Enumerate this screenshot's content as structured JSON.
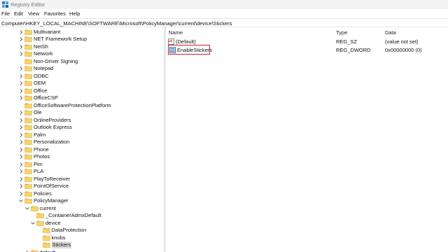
{
  "window": {
    "title": "Registry Editor"
  },
  "menu": [
    "File",
    "Edit",
    "View",
    "Favorites",
    "Help"
  ],
  "address": "Computer\\HKEY_LOCAL_MACHINE\\SOFTWARE\\Microsoft\\PolicyManager\\current\\device\\Stickers",
  "tree": [
    {
      "label": "Multivariant",
      "level": 0,
      "expander": "collapsed"
    },
    {
      "label": "NET Framework Setup",
      "level": 0,
      "expander": "collapsed"
    },
    {
      "label": "NetSh",
      "level": 0,
      "expander": "collapsed"
    },
    {
      "label": "Network",
      "level": 0,
      "expander": "collapsed"
    },
    {
      "label": "Non-Driver Signing",
      "level": 0,
      "expander": "none"
    },
    {
      "label": "Notepad",
      "level": 0,
      "expander": "collapsed"
    },
    {
      "label": "ODBC",
      "level": 0,
      "expander": "collapsed"
    },
    {
      "label": "OEM",
      "level": 0,
      "expander": "collapsed"
    },
    {
      "label": "Office",
      "level": 0,
      "expander": "collapsed"
    },
    {
      "label": "OfficeCSP",
      "level": 0,
      "expander": "collapsed"
    },
    {
      "label": "OfficeSoftwareProtectionPlatform",
      "level": 0,
      "expander": "none"
    },
    {
      "label": "Ole",
      "level": 0,
      "expander": "collapsed"
    },
    {
      "label": "OnlineProviders",
      "level": 0,
      "expander": "collapsed"
    },
    {
      "label": "Outlook Express",
      "level": 0,
      "expander": "collapsed"
    },
    {
      "label": "Palm",
      "level": 0,
      "expander": "collapsed"
    },
    {
      "label": "Personalization",
      "level": 0,
      "expander": "collapsed"
    },
    {
      "label": "Phone",
      "level": 0,
      "expander": "collapsed"
    },
    {
      "label": "Photos",
      "level": 0,
      "expander": "collapsed"
    },
    {
      "label": "Pim",
      "level": 0,
      "expander": "collapsed"
    },
    {
      "label": "PLA",
      "level": 0,
      "expander": "collapsed"
    },
    {
      "label": "PlayToReceiver",
      "level": 0,
      "expander": "collapsed"
    },
    {
      "label": "PointOfService",
      "level": 0,
      "expander": "collapsed"
    },
    {
      "label": "Policies",
      "level": 0,
      "expander": "collapsed"
    },
    {
      "label": "PolicyManager",
      "level": 0,
      "expander": "expanded"
    },
    {
      "label": "current",
      "level": 1,
      "expander": "expanded"
    },
    {
      "label": "_ContainerAdmxDefault",
      "level": 2,
      "expander": "none"
    },
    {
      "label": "device",
      "level": 2,
      "expander": "expanded"
    },
    {
      "label": "DataProtection",
      "level": 3,
      "expander": "none"
    },
    {
      "label": "knobs",
      "level": 3,
      "expander": "none"
    },
    {
      "label": "Stickers",
      "level": 3,
      "expander": "none",
      "selected": true
    },
    {
      "label": "default",
      "level": 1,
      "expander": "collapsed"
    }
  ],
  "list": {
    "columns": {
      "name": "Name",
      "type": "Type",
      "data": "Data"
    },
    "rows": [
      {
        "name": "(Default)",
        "type": "REG_SZ",
        "data": "(value not set)",
        "icon": "string-value-icon"
      },
      {
        "name": "EnableStickers",
        "type": "REG_DWORD",
        "data": "0x00000000 (0)",
        "icon": "binary-value-icon",
        "highlighted": true
      }
    ]
  },
  "colors": {
    "highlight": "#d2202a",
    "folder": "#f7d36b",
    "selection": "#d9d9d9"
  }
}
